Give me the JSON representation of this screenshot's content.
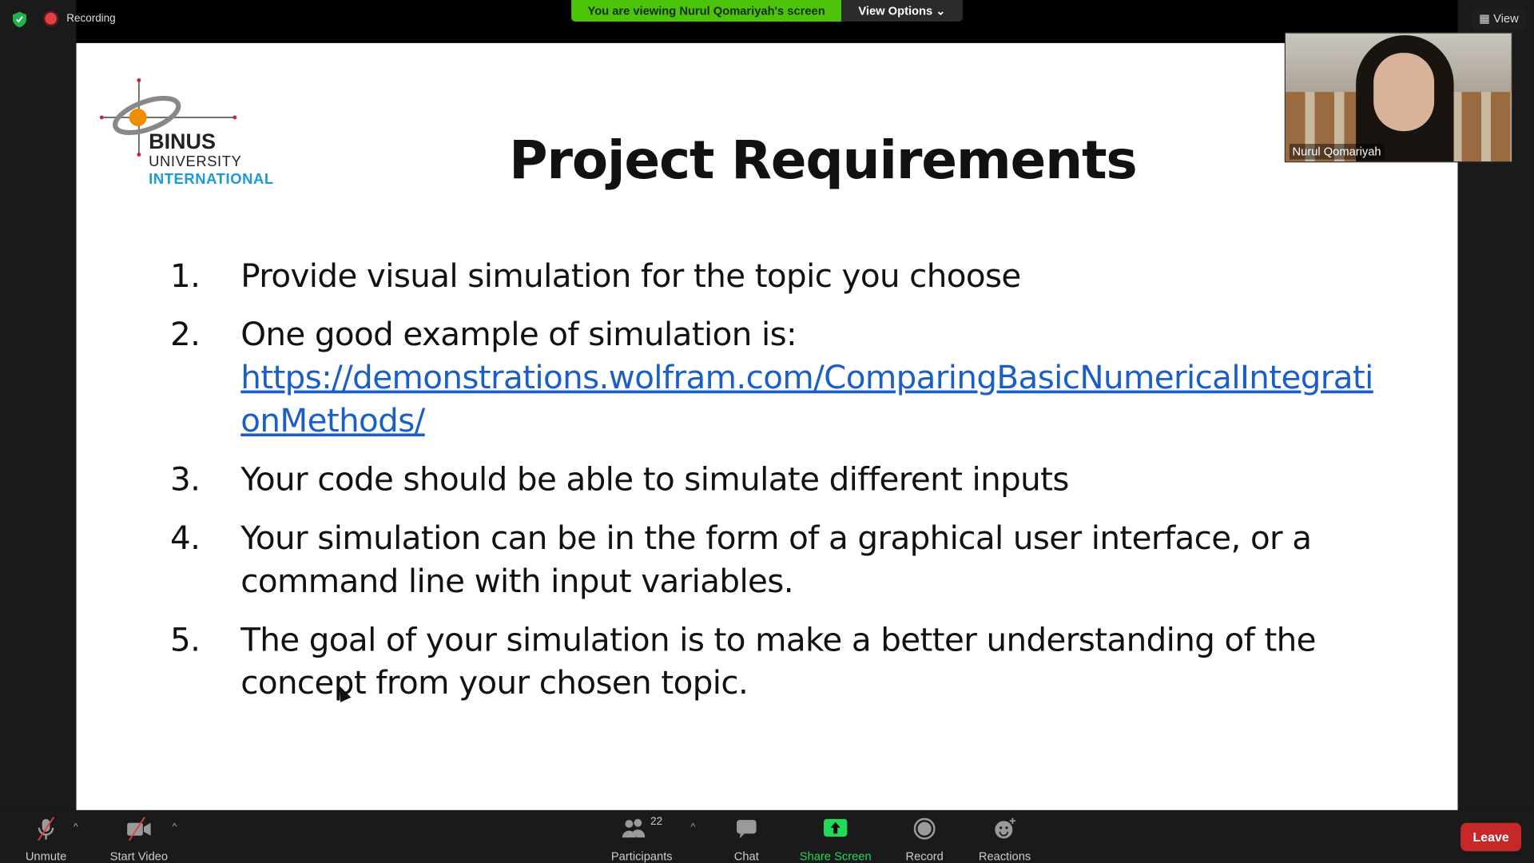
{
  "topbar": {
    "recording": "Recording",
    "viewing_banner": "You are viewing Nurul Qomariyah's screen",
    "view_options": "View Options",
    "view": "View"
  },
  "slide": {
    "logo": {
      "line1": "BINUS",
      "line2": "UNIVERSITY",
      "line3": "INTERNATIONAL"
    },
    "title": "Project Requirements",
    "items": [
      {
        "num": "1.",
        "text": "Provide visual simulation for the topic you choose"
      },
      {
        "num": "2.",
        "text": "One good example of simulation is:",
        "link": "https://demonstrations.wolfram.com/ComparingBasicNumericalIntegrationMethods/"
      },
      {
        "num": "3.",
        "text": "Your code should be able to simulate different inputs"
      },
      {
        "num": "4.",
        "text": "Your simulation can be in the form of a graphical user interface, or a command line with input variables."
      },
      {
        "num": "5.",
        "text": "The goal of your simulation is to make a better understanding of the concept from your chosen topic."
      }
    ]
  },
  "video": {
    "name": "Nurul Qomariyah"
  },
  "toolbar": {
    "unmute": "Unmute",
    "start_video": "Start Video",
    "participants": "Participants",
    "participants_count": "22",
    "chat": "Chat",
    "share_screen": "Share Screen",
    "record": "Record",
    "reactions": "Reactions",
    "leave": "Leave"
  },
  "colors": {
    "share_green": "#23d959",
    "leave_red": "#c62828",
    "banner_green": "#4bc40a",
    "link_blue": "#1a5fc8"
  }
}
